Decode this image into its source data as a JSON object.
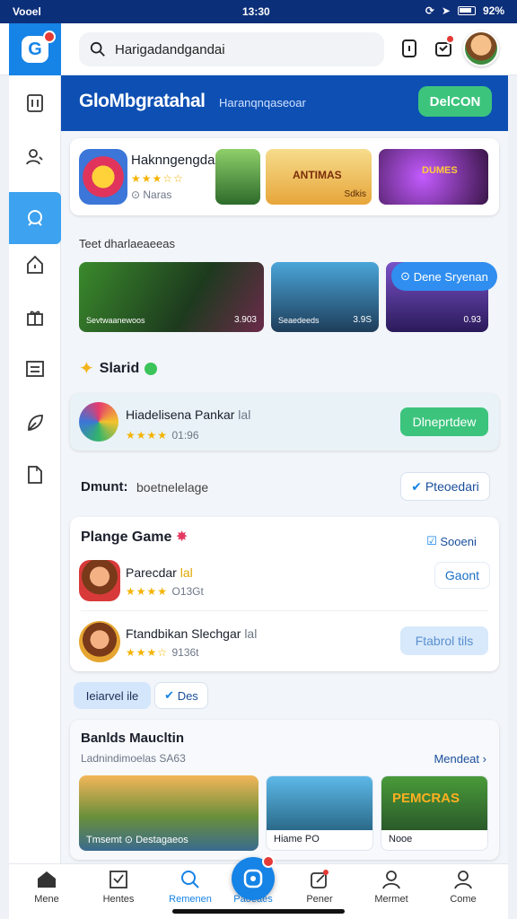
{
  "status": {
    "carrier": "Vooel",
    "time": "13:30",
    "battery": "92%"
  },
  "topbar": {
    "search_text": "Harigadandgandai"
  },
  "hero": {
    "title": "GloMbgratahal",
    "subtitle": "Haranqnqaseoar",
    "button": "DelCON"
  },
  "featured": {
    "name": "Haknngengdai",
    "meta": "Naras",
    "thumbs": [
      {
        "label": ""
      },
      {
        "label": "ANTIMAS",
        "tag": "Sdkis"
      },
      {
        "label": "DUMES",
        "tag": ""
      }
    ]
  },
  "trending": {
    "title": "Teet dharlaeaeeas",
    "items": [
      {
        "caption": "Sevtwaanewoos",
        "value": "3.903"
      },
      {
        "caption": "Seaedeeds",
        "value": "3.9S"
      },
      {
        "caption": "",
        "value": "0.93"
      }
    ],
    "pill": "Dene Sryenan"
  },
  "starred": {
    "title": "Slarid",
    "app_name": "Hiadelisena Pankar",
    "app_tag": "lal",
    "rating_text": "01:96",
    "button": "Dlneprtdew"
  },
  "dmunt": {
    "label": "Dmunt:",
    "value": "boetnelelage",
    "button": "Pteoedari"
  },
  "plange": {
    "title": "Plange Game",
    "sort_button": "Sooeni",
    "items": [
      {
        "name": "Parecdar",
        "tag": "lal",
        "rating_text": "O13Gt",
        "button": "Gaont"
      },
      {
        "name": "Ftandbikan Slechgar",
        "tag": "lal",
        "rating_text": "9136t",
        "button": "Ftabrol tils"
      }
    ]
  },
  "chips": [
    {
      "label": "Ieiarvel ile"
    },
    {
      "label": "Des"
    }
  ],
  "bottom_section": {
    "title": "Banlds Maucltin",
    "subtitle": "Ladnindimoelas SA63",
    "more": "Mendeat",
    "cards": [
      {
        "caption": "Tmsemt",
        "sub": "Destagaeos"
      },
      {
        "caption": "Hiame",
        "sub": "PO"
      },
      {
        "caption": "Nooe",
        "sub": ""
      }
    ],
    "banner_text": "PEMCRAS"
  },
  "bottom_nav": [
    {
      "label": "Mene"
    },
    {
      "label": "Hentes"
    },
    {
      "label": "Remenen"
    },
    {
      "label": "Paoeaes"
    },
    {
      "label": "Pener"
    },
    {
      "label": "Mermet"
    },
    {
      "label": "Come"
    }
  ],
  "colors": {
    "accent": "#1683e6",
    "hero": "#0e4fb3",
    "green": "#3cc47d",
    "star": "#f5b301"
  }
}
